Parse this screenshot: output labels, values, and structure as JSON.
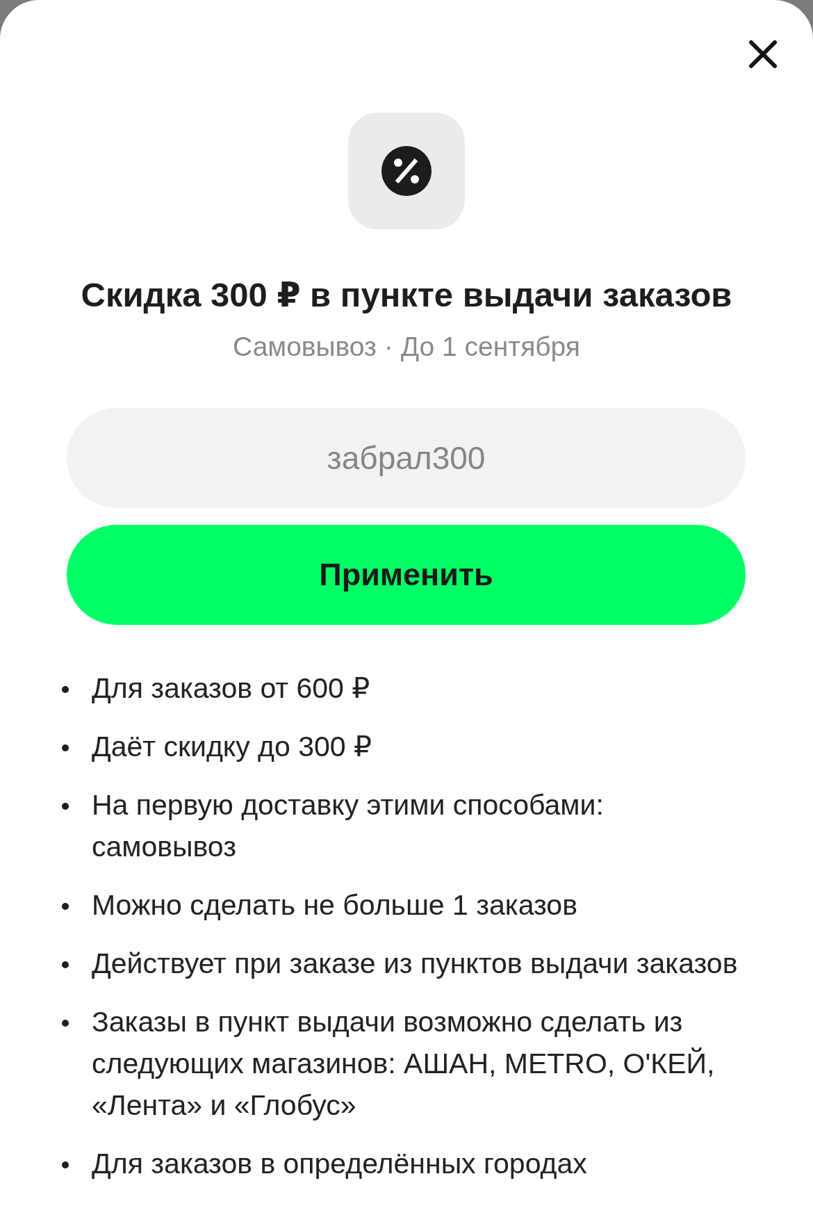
{
  "sheet": {
    "title": "Скидка 300 ₽ в пункте выдачи заказов",
    "subtitle": "Самовывоз · До 1 сентября"
  },
  "promo_field": {
    "placeholder": "забрал300"
  },
  "apply_button": {
    "label": "Применить"
  },
  "conditions": [
    "Для заказов от 600 ₽",
    "Даёт скидку до 300 ₽",
    "На первую доставку этими способами: самовывоз",
    "Можно сделать не больше 1 заказов",
    "Действует при заказе из пунктов выдачи заказов",
    "Заказы в пункт выдачи возможно сделать из следующих магазинов: АШАН, METRO, О'КЕЙ, «Лента» и «Глобус»",
    "Для заказов в определённых городах"
  ]
}
